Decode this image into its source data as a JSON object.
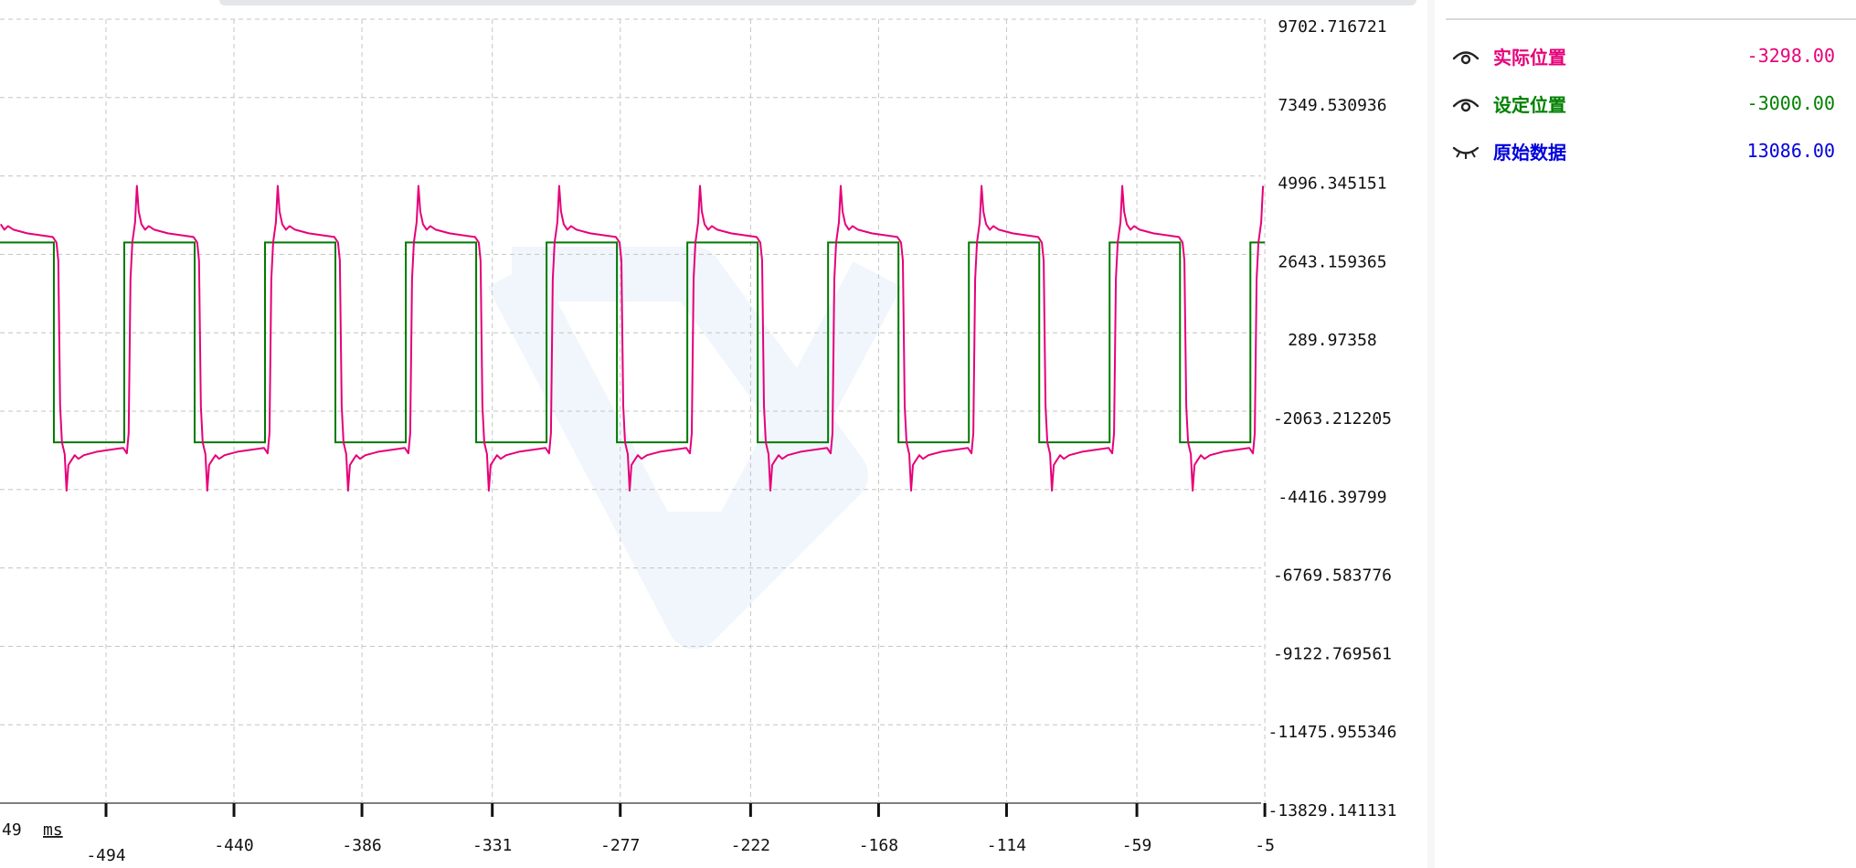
{
  "chart_data": {
    "type": "line",
    "xlabel": "",
    "ylabel": "",
    "x_unit": "ms",
    "x_ticks": [
      -494,
      -440,
      -386,
      -331,
      -277,
      -222,
      -168,
      -114,
      -59,
      -5
    ],
    "x_partial_tick": "49",
    "y_ticks": [
      9702.716721,
      7349.530936,
      4996.345151,
      2643.159365,
      289.97358,
      -2063.212205,
      -4416.39799,
      -6769.583776,
      -9122.769561,
      -11475.955346,
      -13829.141131
    ],
    "y_tick_labels": [
      "9702.716721",
      "7349.530936",
      "4996.345151",
      "2643.159365",
      "289.97358",
      "-2063.212205",
      "-4416.39799",
      "-6769.583776",
      "-9122.769561",
      "-11475.955346",
      "-13829.141131"
    ],
    "ylim": [
      -13829.141131,
      9702.716721
    ],
    "grid": true,
    "legend_position": "right-panel",
    "series": [
      {
        "name": "实际位置",
        "color": "#e6007a",
        "shape": "square wave with overshoot spikes",
        "high": 3000,
        "low": -3000,
        "overshoot_peak": 4700,
        "undershoot_peak": -4450,
        "period_ms": 59.4,
        "first_rise_ms": -544.6
      },
      {
        "name": "设定位置",
        "color": "#007a00",
        "shape": "square wave",
        "high": 3000,
        "low": -3000,
        "period_ms": 59.4,
        "first_rise_ms": -545.7
      }
    ],
    "watermark": "logo"
  },
  "legend": {
    "items": [
      {
        "icon": "eye-open-icon",
        "name": "实际位置",
        "value": "-3298.00",
        "color": "#e6007a"
      },
      {
        "icon": "eye-open-icon",
        "name": "设定位置",
        "value": "-3000.00",
        "color": "#008000"
      },
      {
        "icon": "eye-closed-icon",
        "name": "原始数据",
        "value": "13086.00",
        "color": "#0000dd"
      }
    ]
  }
}
